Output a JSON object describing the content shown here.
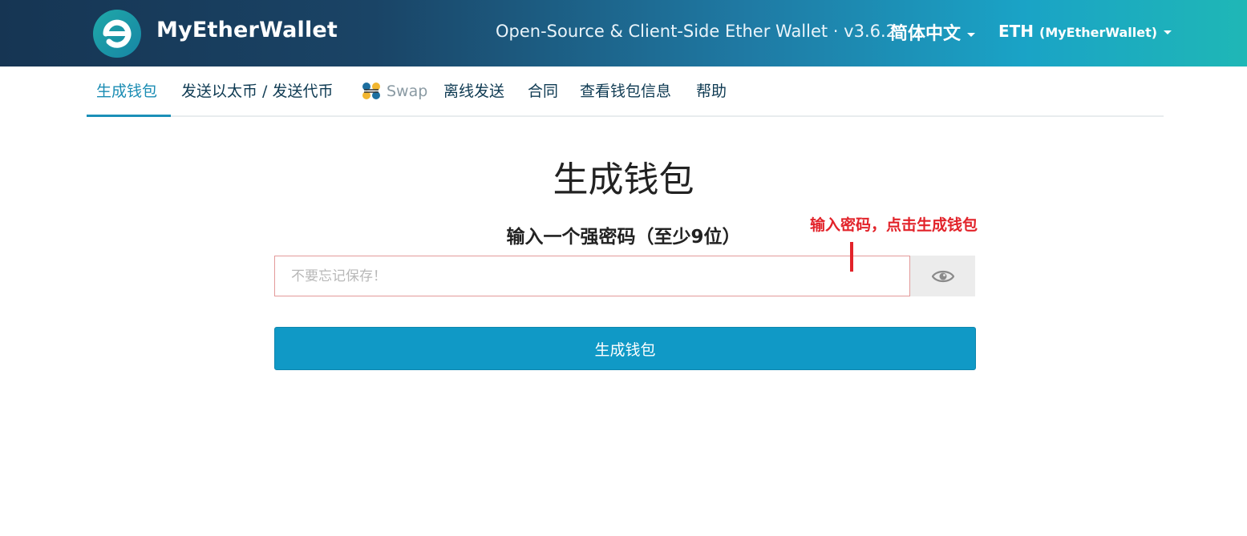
{
  "header": {
    "brand": "MyEtherWallet",
    "tagline": "Open-Source & Client-Side Ether Wallet · v3.6.2",
    "language": "简体中文",
    "network_main": "ETH",
    "network_sub": "(MyEtherWallet)",
    "logo_icon": "myetherwallet-logo-icon"
  },
  "nav": {
    "items": [
      {
        "label": "生成钱包",
        "active": true
      },
      {
        "label": "发送以太币 / 发送代币"
      },
      {
        "label": "Swap",
        "icon": "swap-icon"
      },
      {
        "label": "离线发送"
      },
      {
        "label": "合同"
      },
      {
        "label": "查看钱包信息"
      },
      {
        "label": "帮助"
      }
    ]
  },
  "main": {
    "title": "生成钱包",
    "subtitle": "输入一个强密码（至少9位）",
    "password_placeholder": "不要忘记保存！",
    "password_value": "",
    "show_password_icon": "eye-icon",
    "generate_button": "生成钱包"
  },
  "annotation": {
    "text": "输入密码，点击生成钱包",
    "color": "#e2232a"
  },
  "colors": {
    "accent": "#1099c6",
    "nav_active": "#1a8cb3",
    "header_start": "#163553",
    "header_end": "#1fb7b6"
  }
}
